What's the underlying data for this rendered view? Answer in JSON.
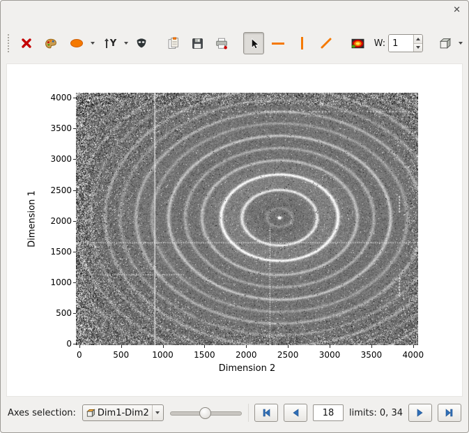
{
  "window": {
    "close_glyph": "✕"
  },
  "toolbar": {
    "width_label": "W:",
    "width_value": "1"
  },
  "plot": {
    "xlabel": "Dimension 2",
    "ylabel": "Dimension 1",
    "x_ticks": [
      0,
      500,
      1000,
      1500,
      2000,
      2500,
      3000,
      3500,
      4000
    ],
    "y_ticks": [
      0,
      500,
      1000,
      1500,
      2000,
      2500,
      3000,
      3500,
      4000
    ],
    "x_range": [
      -40,
      4060
    ],
    "y_range": [
      -20,
      4080
    ],
    "image": {
      "center": [
        2400,
        2050
      ],
      "base_gray": 108,
      "noise": 27,
      "center_peak": 170,
      "ring_width": 22,
      "rings": [
        [
          150,
          35
        ],
        [
          450,
          110
        ],
        [
          700,
          130
        ],
        [
          930,
          70
        ],
        [
          1130,
          55
        ],
        [
          1330,
          80
        ],
        [
          1530,
          45
        ],
        [
          1720,
          60
        ],
        [
          1910,
          40
        ],
        [
          2090,
          55
        ],
        [
          2270,
          35
        ],
        [
          2450,
          45
        ],
        [
          2640,
          30
        ],
        [
          2830,
          35
        ],
        [
          3020,
          25
        ],
        [
          3220,
          30
        ]
      ],
      "halo": [
        [
          600,
          300,
          20
        ],
        [
          1500,
          700,
          8
        ]
      ],
      "overlays": {
        "solid_vline_x": 900,
        "dotted_hline_y": 1650,
        "dotted_vline": {
          "x": 2280,
          "y0": 0,
          "y1": 1900
        },
        "dotted_segment": {
          "y": 1130,
          "x0": 250,
          "x1": 1250
        },
        "top_dotted": {
          "y": 3780,
          "x0": 1100,
          "x1": 4050
        },
        "right_dashes": [
          {
            "x": 3830,
            "y0": 2120,
            "y1": 2400
          },
          {
            "x": 3830,
            "y0": 780,
            "y1": 1080
          }
        ]
      }
    }
  },
  "bottombar": {
    "axes_label": "Axes selection:",
    "combo_value": "Dim1-Dim2",
    "frame_value": "18",
    "limits_text": "limits: 0, 34"
  }
}
